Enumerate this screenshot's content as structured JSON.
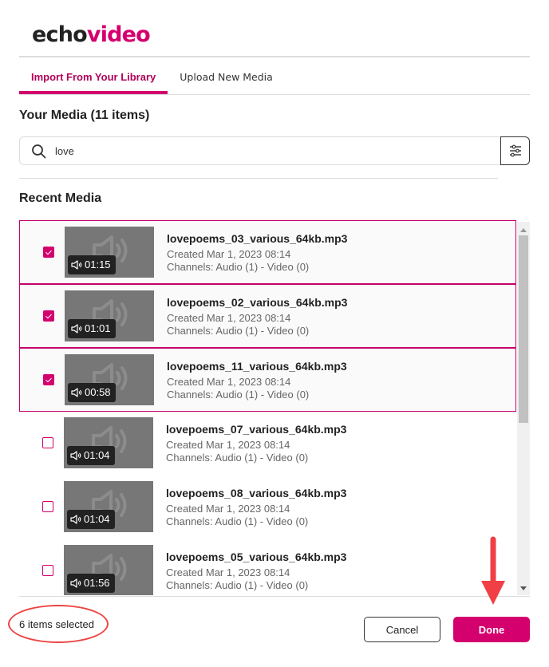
{
  "app": {
    "logo_part1": "echo",
    "logo_part2": "video",
    "brand_color": "#d4006e"
  },
  "tabs": [
    {
      "label": "Import From Your Library",
      "active": true
    },
    {
      "label": "Upload New Media",
      "active": false
    }
  ],
  "media_section": {
    "title": "Your Media (11 items)"
  },
  "search": {
    "value": "love",
    "icon": "search-icon",
    "filter_icon": "sliders-icon"
  },
  "recent": {
    "title": "Recent Media",
    "items": [
      {
        "title": "lovepoems_03_various_64kb.mp3",
        "created": "Created Mar 1, 2023 08:14",
        "channels": "Channels: Audio (1) - Video (0)",
        "duration": "01:15",
        "checked": true
      },
      {
        "title": "lovepoems_02_various_64kb.mp3",
        "created": "Created Mar 1, 2023 08:14",
        "channels": "Channels: Audio (1) - Video (0)",
        "duration": "01:01",
        "checked": true
      },
      {
        "title": "lovepoems_11_various_64kb.mp3",
        "created": "Created Mar 1, 2023 08:14",
        "channels": "Channels: Audio (1) - Video (0)",
        "duration": "00:58",
        "checked": true
      },
      {
        "title": "lovepoems_07_various_64kb.mp3",
        "created": "Created Mar 1, 2023 08:14",
        "channels": "Channels: Audio (1) - Video (0)",
        "duration": "01:04",
        "checked": false
      },
      {
        "title": "lovepoems_08_various_64kb.mp3",
        "created": "Created Mar 1, 2023 08:14",
        "channels": "Channels: Audio (1) - Video (0)",
        "duration": "01:04",
        "checked": false
      },
      {
        "title": "lovepoems_05_various_64kb.mp3",
        "created": "Created Mar 1, 2023 08:14",
        "channels": "Channels: Audio (1) - Video (0)",
        "duration": "01:56",
        "checked": false
      }
    ]
  },
  "footer": {
    "selected_count": "6 items selected",
    "cancel_label": "Cancel",
    "done_label": "Done"
  },
  "annotations": {
    "ellipse_color": "#ee4444",
    "arrow_color": "#f04046"
  }
}
